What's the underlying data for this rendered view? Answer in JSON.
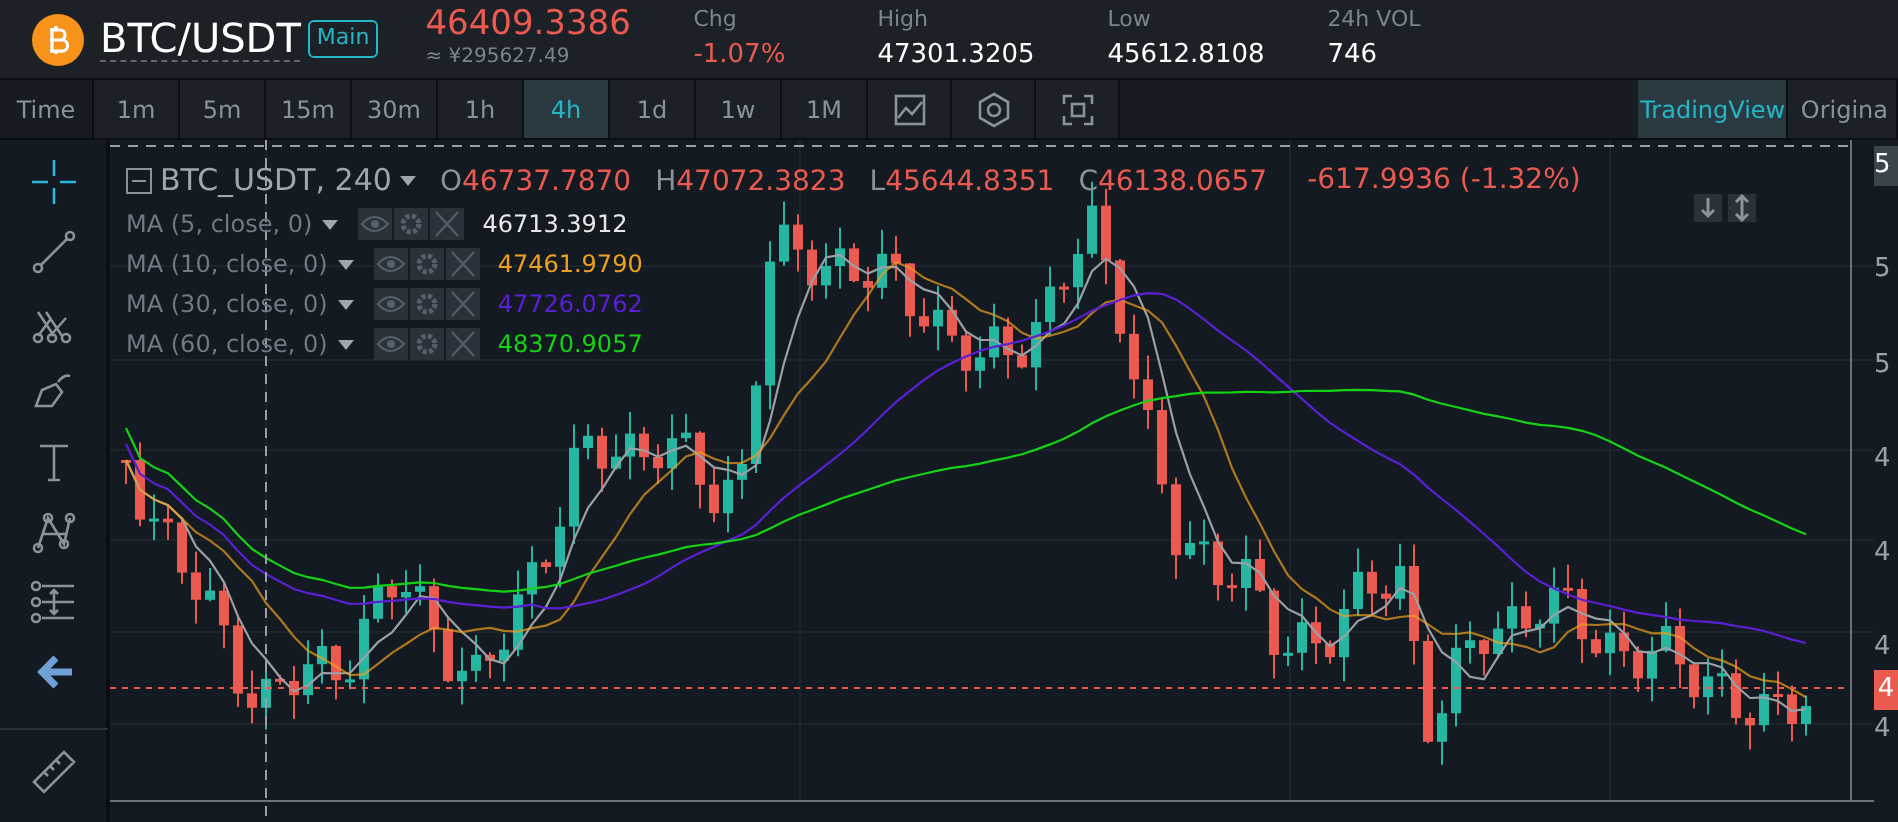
{
  "header": {
    "pair": "BTC/USDT",
    "badge": "Main",
    "price": "46409.3386",
    "price_cny": "≈ ¥295627.49",
    "stats": [
      {
        "label": "Chg",
        "value": "-1.07%",
        "kind": "negative"
      },
      {
        "label": "High",
        "value": "47301.3205",
        "kind": "neutral"
      },
      {
        "label": "Low",
        "value": "45612.8108",
        "kind": "neutral"
      },
      {
        "label": "24h VOL",
        "value": "746",
        "kind": "neutral"
      }
    ]
  },
  "toolbar": {
    "label": "Time",
    "intervals": [
      {
        "label": "1m",
        "selected": false
      },
      {
        "label": "5m",
        "selected": false
      },
      {
        "label": "15m",
        "selected": false
      },
      {
        "label": "30m",
        "selected": false
      },
      {
        "label": "1h",
        "selected": false
      },
      {
        "label": "4h",
        "selected": true
      },
      {
        "label": "1d",
        "selected": false
      },
      {
        "label": "1w",
        "selected": false
      },
      {
        "label": "1M",
        "selected": false
      }
    ],
    "tools": [
      {
        "kind": "chart"
      },
      {
        "kind": "settings"
      },
      {
        "kind": "fullscreen"
      }
    ],
    "views": [
      {
        "label": "TradingView",
        "selected": true
      },
      {
        "label": "Origina",
        "selected": false
      }
    ]
  },
  "drawing_tools": [
    {
      "kind": "crosshair",
      "selected": true
    },
    {
      "kind": "line",
      "selected": false
    },
    {
      "kind": "fork",
      "selected": false
    },
    {
      "kind": "brush",
      "selected": false
    },
    {
      "kind": "text",
      "selected": false
    },
    {
      "kind": "pattern",
      "selected": false
    },
    {
      "kind": "measure",
      "selected": false
    },
    {
      "kind": "back",
      "selected": true
    },
    {
      "kind": "ruler",
      "selected": false
    }
  ],
  "legend": {
    "symbol": "BTC_USDT, 240",
    "ohlc": [
      {
        "label": "O",
        "value": "46737.7870"
      },
      {
        "label": "H",
        "value": "47072.3823"
      },
      {
        "label": "L",
        "value": "45644.8351"
      },
      {
        "label": "C",
        "value": "46138.0657"
      }
    ],
    "change": "-617.9936 (-1.32%)"
  },
  "indicators": [
    {
      "label": "MA (5, close, 0)",
      "value": "46713.3912",
      "color": "#e8e8e8"
    },
    {
      "label": "MA (10, close, 0)",
      "value": "47461.9790",
      "color": "#f0a020"
    },
    {
      "label": "MA (30, close, 0)",
      "value": "47726.0762",
      "color": "#5b1fd6"
    },
    {
      "label": "MA (60, close, 0)",
      "value": "48370.9057",
      "color": "#16d216"
    }
  ],
  "price_axis": {
    "labels": [
      "5",
      "5",
      "5",
      "4",
      "4",
      "4",
      "4"
    ],
    "last_price": "4"
  }
}
